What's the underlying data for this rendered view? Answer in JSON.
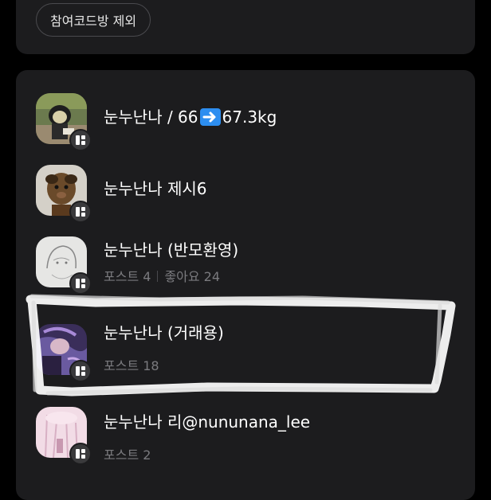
{
  "filter_chip": {
    "label": "참여코드방 제외"
  },
  "rooms": [
    {
      "title_prefix": "눈누난나 / 66",
      "title_suffix": "67.3kg",
      "icon": "arrow-right-emoji",
      "meta": null
    },
    {
      "title": "눈누난나 제시6",
      "meta": null
    },
    {
      "title": "눈누난나 (반모환영)",
      "posts": "포스트 4",
      "likes": "좋아요 24"
    },
    {
      "title": "눈누난나 (거래용)",
      "posts": "포스트 18"
    },
    {
      "title": "눈누난나 리@nununana_lee",
      "posts": "포스트 2"
    }
  ],
  "colors": {
    "background": "#000000",
    "card": "#1c1c1e",
    "meta_text": "#7a7a7e",
    "arrow_emoji": "#2d8ef0"
  }
}
